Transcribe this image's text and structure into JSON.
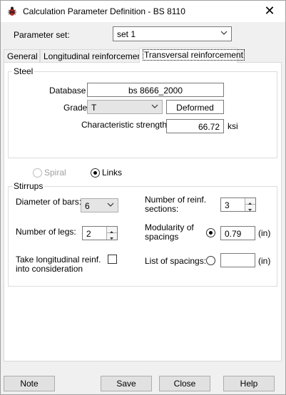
{
  "window": {
    "title": "Calculation Parameter Definition - BS 8110",
    "app_icon": "bug-icon",
    "close_icon": "close-icon",
    "close_glyph": "✕"
  },
  "parameter_set": {
    "label": "Parameter set:",
    "value": "set 1"
  },
  "tabs": [
    {
      "label": "General",
      "active": false
    },
    {
      "label": "Longitudinal reinforcement",
      "active": false
    },
    {
      "label": "Transversal reinforcement",
      "active": true
    }
  ],
  "steel": {
    "caption": "Steel",
    "database_label": "Database",
    "database_value": "bs 8666_2000",
    "grade_label": "Grade",
    "grade_value": "T",
    "grade_type": "Deformed",
    "strength_label": "Characteristic strength",
    "strength_value": "66.72",
    "strength_unit": "ksi"
  },
  "type_options": {
    "spiral_label": "Spiral",
    "links_label": "Links",
    "selected": "Links"
  },
  "stirrups": {
    "caption": "Stirrups",
    "diameter_label": "Diameter of bars:",
    "diameter_value": "6",
    "legs_label": "Number of legs:",
    "legs_value": "2",
    "take_long_label_1": "Take longitudinal reinf.",
    "take_long_label_2": "into consideration",
    "take_long_checked": false,
    "sections_label_1": "Number of reinf.",
    "sections_label_2": "sections:",
    "sections_value": "3",
    "modularity_label_1": "Modularity of",
    "modularity_label_2": "spacings",
    "modularity_value": "0.79",
    "modularity_unit": "(in)",
    "list_label": "List of spacings:",
    "list_value": "",
    "list_unit": "(in)",
    "spacing_mode": "modularity"
  },
  "buttons": {
    "note": "Note",
    "save": "Save",
    "close": "Close",
    "help": "Help"
  },
  "colors": {
    "window_bg": "#f0f0f0",
    "panel_bg": "#ffffff",
    "button_bg": "#e1e1e1",
    "disabled_text": "#a0a0a0"
  }
}
